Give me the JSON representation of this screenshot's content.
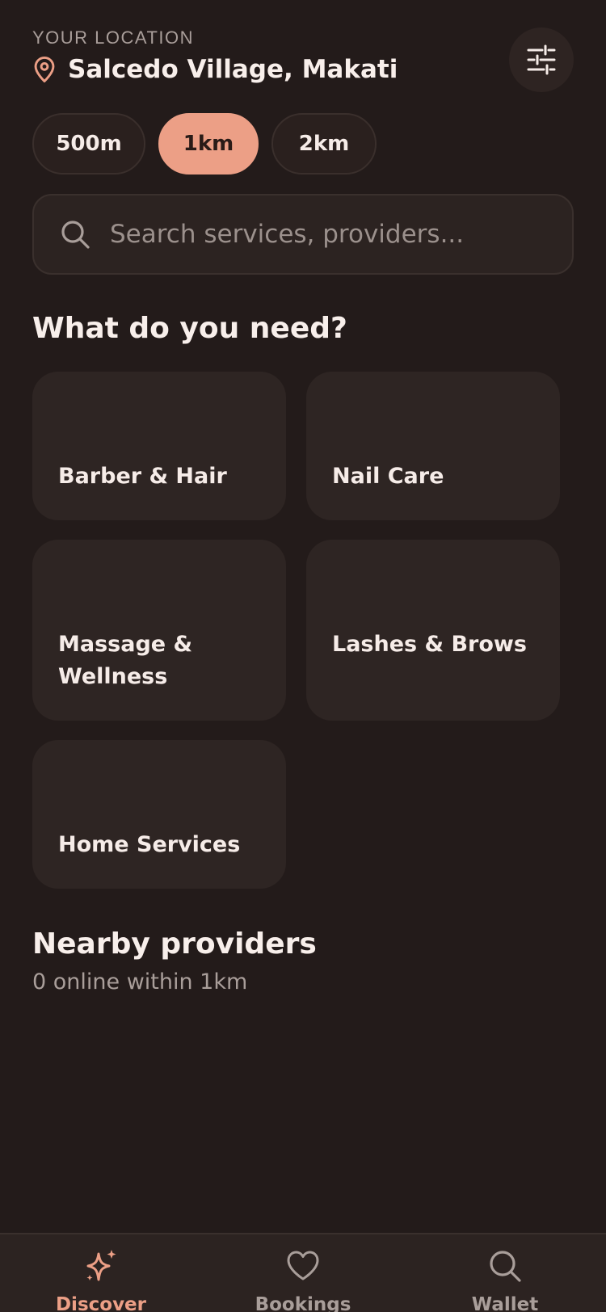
{
  "location": {
    "label": "YOUR LOCATION",
    "name": "Salcedo Village, Makati"
  },
  "radius_chips": [
    {
      "label": "500m",
      "selected": false
    },
    {
      "label": "1km",
      "selected": true
    },
    {
      "label": "2km",
      "selected": false
    }
  ],
  "search": {
    "placeholder": "Search services, providers..."
  },
  "categories_section": {
    "title": "What do you need?",
    "items": [
      {
        "label": "Barber & Hair"
      },
      {
        "label": "Nail Care"
      },
      {
        "label": "Massage & Wellness"
      },
      {
        "label": "Lashes & Brows"
      },
      {
        "label": "Home Services"
      }
    ]
  },
  "nearby": {
    "title": "Nearby providers",
    "subtitle": "0 online within 1km"
  },
  "tabbar": {
    "tabs": [
      {
        "label": "Discover",
        "icon": "sparkle-icon",
        "active": true
      },
      {
        "label": "Bookings",
        "icon": "heart-icon",
        "active": false
      },
      {
        "label": "Wallet",
        "icon": "search-icon",
        "active": false
      }
    ]
  },
  "colors": {
    "background": "#231b1a",
    "card": "#2e2523",
    "accent": "#ec9f86",
    "text": "#f6ece8",
    "muted": "#a99e9a"
  }
}
